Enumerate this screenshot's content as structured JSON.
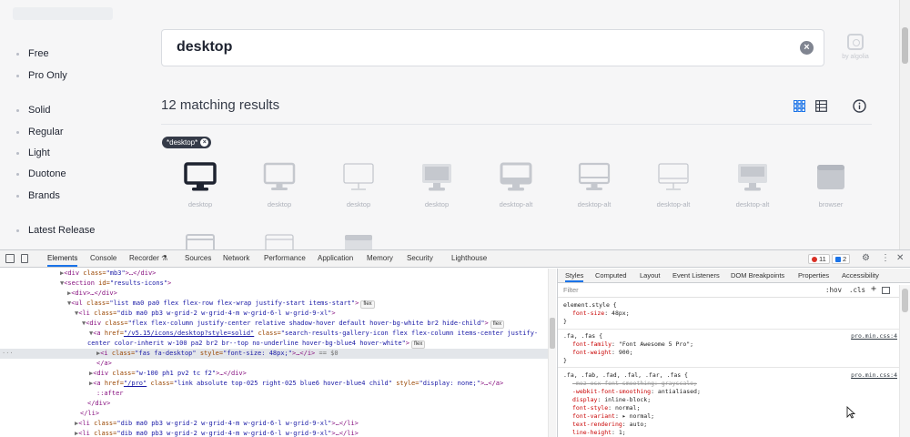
{
  "sidebar": {
    "items": [
      {
        "label": "Free"
      },
      {
        "label": "Pro Only"
      },
      {
        "label": "Solid"
      },
      {
        "label": "Regular"
      },
      {
        "label": "Light"
      },
      {
        "label": "Duotone"
      },
      {
        "label": "Brands"
      },
      {
        "label": "Latest Release"
      }
    ]
  },
  "search": {
    "value": "desktop",
    "clear_icon": "×",
    "provider": "by algolia"
  },
  "results": {
    "title": "12 matching results",
    "filter_chip": "*desktop*",
    "filter_chip_remove": "×",
    "icons": [
      {
        "label": "desktop",
        "selected": true
      },
      {
        "label": "desktop"
      },
      {
        "label": "desktop"
      },
      {
        "label": "desktop"
      },
      {
        "label": "desktop-alt"
      },
      {
        "label": "desktop-alt"
      },
      {
        "label": "desktop-alt"
      },
      {
        "label": "desktop-alt"
      },
      {
        "label": "browser"
      }
    ]
  },
  "colors": {
    "accent_blue": "#1a73e8",
    "icon_dark": "#1e2330",
    "icon_light": "#c5c8ce"
  },
  "devtools": {
    "tabs": [
      "Elements",
      "Console",
      "Recorder",
      "Sources",
      "Network",
      "Performance",
      "Application",
      "Memory",
      "Security",
      "Lighthouse"
    ],
    "active_tab": "Elements",
    "errors_count": "11",
    "messages_count": "2",
    "elements": {
      "l1": {
        "tag": "<div ",
        "an": "class=",
        "av": "\"mb3\"",
        "rest": ">…</div>"
      },
      "l2": {
        "tag": "<section ",
        "an": "id=",
        "av": "\"results-icons\"",
        "rest": ">"
      },
      "l3": {
        "tag": "<div>…</div>"
      },
      "l4": {
        "tag": "<ul ",
        "an": "class=",
        "av": "\"list ma0 pa0 flex flex-row flex-wrap justify-start items-start\"",
        "rest": ">",
        "flag": "flex"
      },
      "l5": {
        "tag": "<li ",
        "an": "class=",
        "av": "\"dib ma0 pb3 w-grid-2 w-grid-4-m w-grid-6-l w-grid-9-xl\"",
        "rest": ">"
      },
      "l6": {
        "tag": "<div ",
        "an": "class=",
        "av": "\"flex flex-column justify-center relative shadow-hover default hover-bg-white br2 hide-child\"",
        "rest": ">",
        "flag": "flex"
      },
      "l7": {
        "tag": "<a ",
        "an": "href=",
        "link": "\"/v5.15/icons/desktop?style=solid\"",
        "an2": " class=",
        "av": "\"search-results-gallery-icon flex flex-column items-center justify-"
      },
      "l8": {
        "av": "center color-inherit w-100 pa2 br2 br--top no-underline hover-bg-blue4 hover-white\"",
        "rest": ">",
        "flag": "flex"
      },
      "l9": {
        "tag": "<i ",
        "an": "class=",
        "av": "\"fas fa-desktop\"",
        "an2": " style=",
        "av2": "\"font-size: 48px;\"",
        "rest": ">…</i>",
        "eq": " == $0"
      },
      "l10": {
        "tag": "</a>"
      },
      "l11": {
        "tag": "<div ",
        "an": "class=",
        "av": "\"w-100 ph1 pv2 tc f2\"",
        "rest": ">…</div>"
      },
      "l12": {
        "tag": "<a ",
        "an": "href=",
        "link": "\"/pro\"",
        "an2": " class=",
        "av": "\"link absolute top-025 right-025 blue6 hover-blue4 child\"",
        "an3": " style=",
        "av2": "\"display: none;\"",
        "rest": ">…</a>"
      },
      "l13": {
        "pseudo": "::after"
      },
      "l14": {
        "tag": "</div>"
      },
      "l15": {
        "tag": "</li>"
      },
      "l16": {
        "tag": "<li ",
        "an": "class=",
        "av": "\"dib ma0 pb3 w-grid-2 w-grid-4-m w-grid-6-l w-grid-9-xl\"",
        "rest": ">…</li>"
      },
      "l17": {
        "tag": "<li ",
        "an": "class=",
        "av": "\"dib ma0 pb3 w-grid-2 w-grid-4-m w-grid-6-l w-grid-9-xl\"",
        "rest": ">…</li>"
      }
    },
    "styles": {
      "tabs": [
        "Styles",
        "Computed",
        "Layout",
        "Event Listeners",
        "DOM Breakpoints",
        "Properties",
        "Accessibility"
      ],
      "active_tab": "Styles",
      "filter_placeholder": "Filter",
      "hov": ":hov",
      "cls": ".cls",
      "plus": "+",
      "r1_sel": "element.style {",
      "r1_p1": "font-size",
      "r1_v1": ": 48px;",
      "r1_end": "}",
      "r2_sel": ".fa, .fas {",
      "r2_src": "pro.min.css:4",
      "r2_p1": "font-family",
      "r2_v1": ": \"Font Awesome 5 Pro\";",
      "r2_p2": "font-weight",
      "r2_v2": ": 900;",
      "r2_end": "}",
      "r3_sel": ".fa, .fab, .fad, .fal, .far, .fas {",
      "r3_src": "pro.min.css:4",
      "r3_p1": "-moz-osx-font-smoothing",
      "r3_v1": ": grayscale;",
      "r3_p2": "-webkit-font-smoothing",
      "r3_v2": ": antialiased;",
      "r3_p3": "display",
      "r3_v3": ": inline-block;",
      "r3_p4": "font-style",
      "r3_v4": ": normal;",
      "r3_p5": "font-variant",
      "r3_v5": ": ▸ normal;",
      "r3_p6": "text-rendering",
      "r3_v6": ": auto;",
      "r3_p7": "line-height",
      "r3_v7": ": 1;"
    }
  }
}
